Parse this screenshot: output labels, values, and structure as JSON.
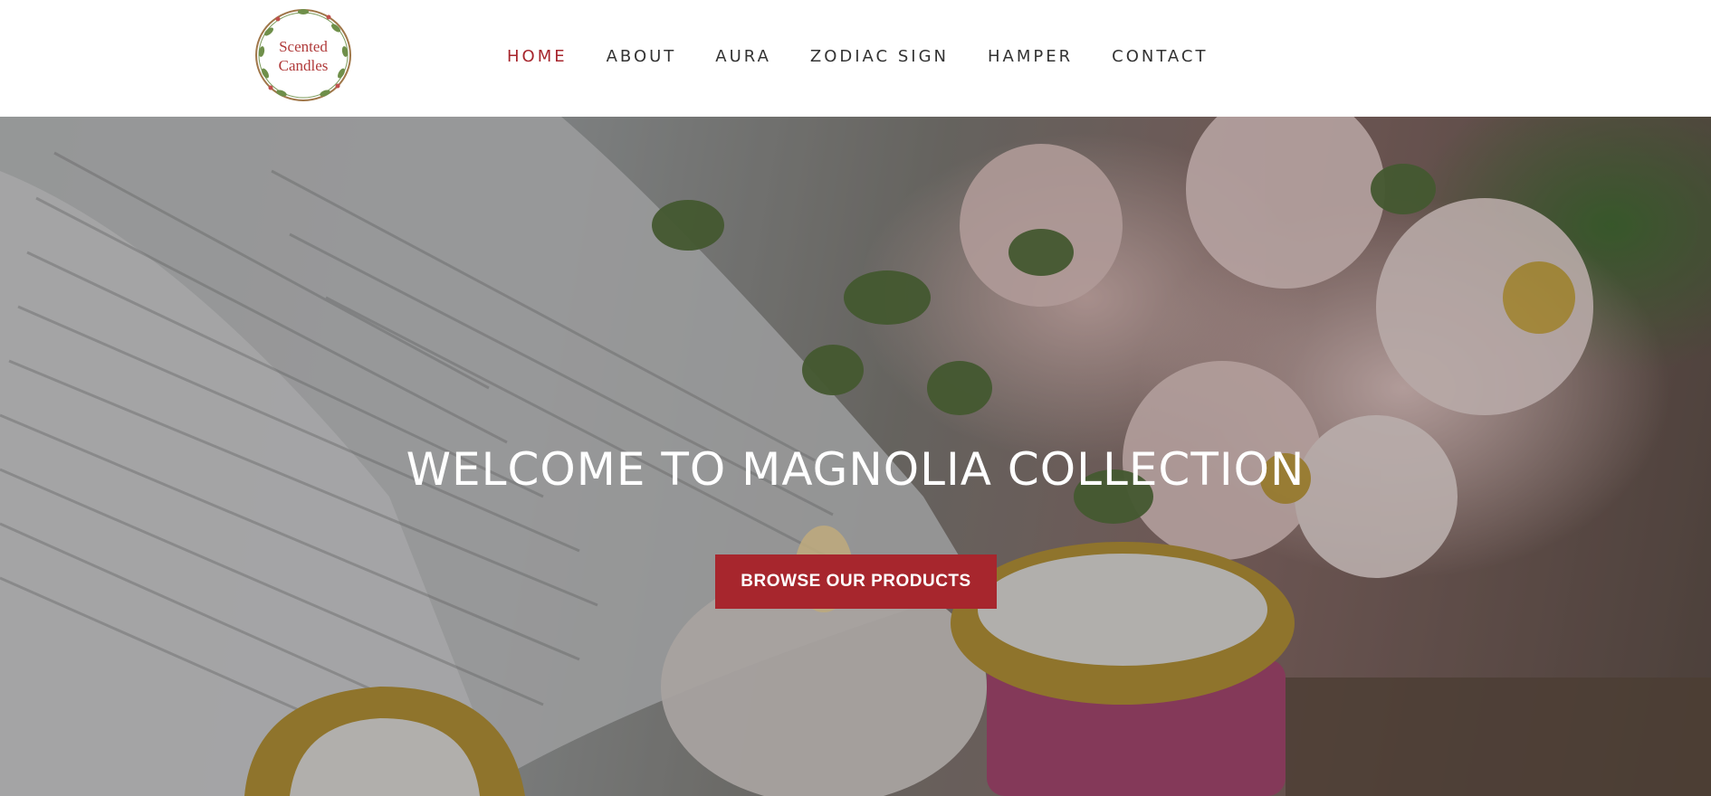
{
  "logo": {
    "line1": "Scented",
    "line2": "Candles",
    "icon": "wreath-logo"
  },
  "nav": {
    "items": [
      {
        "label": "HOME",
        "active": true
      },
      {
        "label": "ABOUT",
        "active": false
      },
      {
        "label": "AURA",
        "active": false
      },
      {
        "label": "ZODIAC SIGN",
        "active": false
      },
      {
        "label": "HAMPER",
        "active": false
      },
      {
        "label": "CONTACT",
        "active": false
      }
    ]
  },
  "hero": {
    "title": "WELCOME TO MAGNOLIA COLLECTION",
    "button_label": "BROWSE OUR PRODUCTS"
  },
  "colors": {
    "accent": "#a7262d",
    "nav_text": "#333333",
    "hero_text": "#ffffff"
  }
}
